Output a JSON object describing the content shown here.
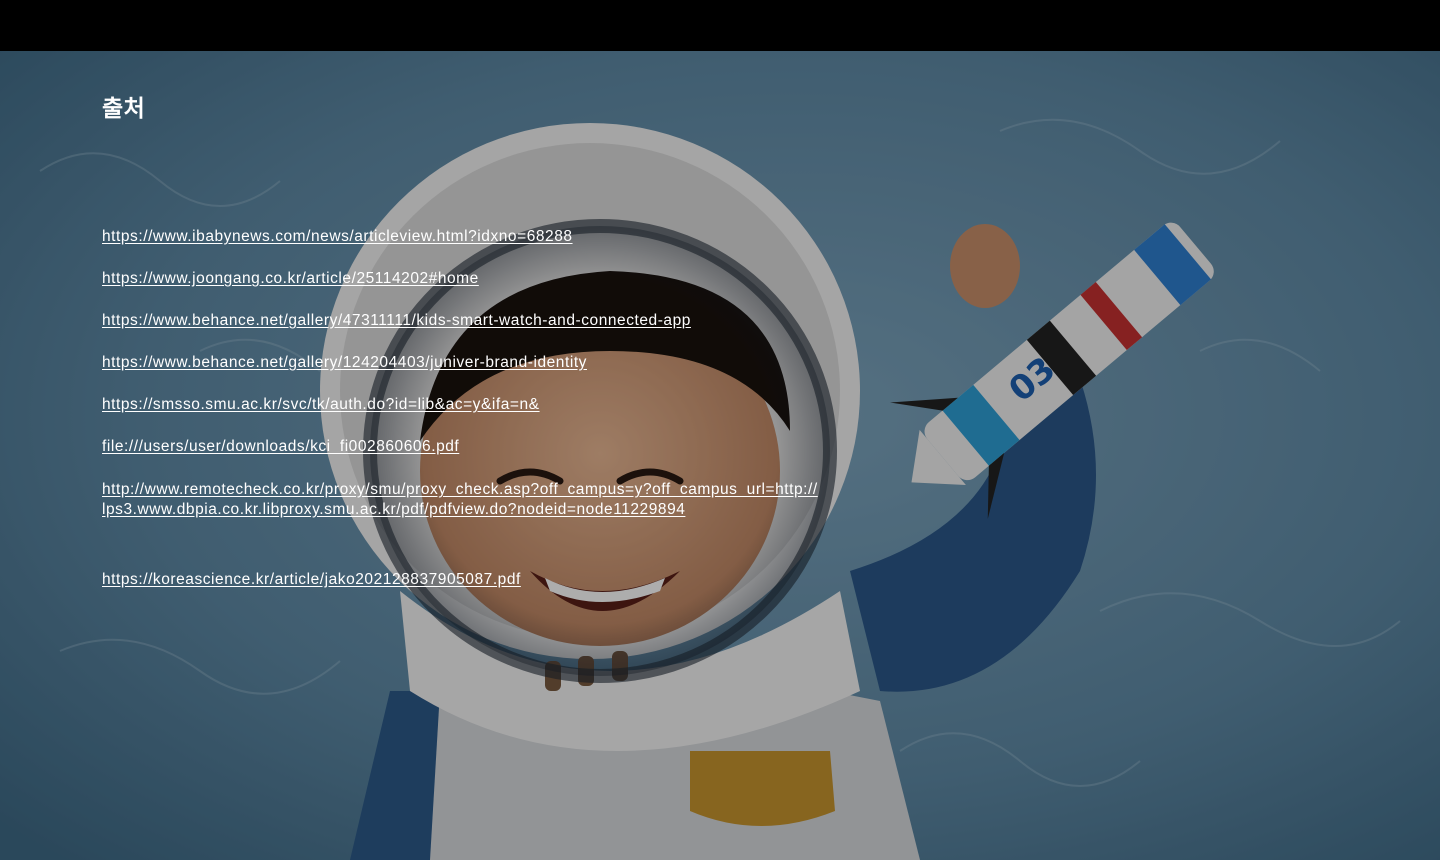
{
  "slide": {
    "title": "출처",
    "background_image": "child-astronaut-helmet-toy-rocket-photo"
  },
  "links": [
    {
      "text": "https://www.ibabynews.com/news/articleview.html?idxno=68288"
    },
    {
      "text": "https://www.joongang.co.kr/article/25114202#home"
    },
    {
      "text": "https://www.behance.net/gallery/47311111/kids-smart-watch-and-connected-app"
    },
    {
      "text": "https://www.behance.net/gallery/124204403/juniver-brand-identity"
    },
    {
      "text": "https://smsso.smu.ac.kr/svc/tk/auth.do?id=lib&ac=y&ifa=n&"
    },
    {
      "text": "file:///users/user/downloads/kci_fi002860606.pdf"
    },
    {
      "text": "http://www.remotecheck.co.kr/proxy/smu/proxy_check.asp?off_campus=y?off_campus_url=http://\nlps3.www.dbpia.co.kr.libproxy.smu.ac.kr/pdf/pdfview.do?nodeid=node11229894"
    },
    {
      "text": "https://koreascience.kr/article/jako202128837905087.pdf"
    }
  ],
  "colors": {
    "text": "#ffffff",
    "top_bar": "#000000",
    "fur_background": "#5d88a3"
  }
}
